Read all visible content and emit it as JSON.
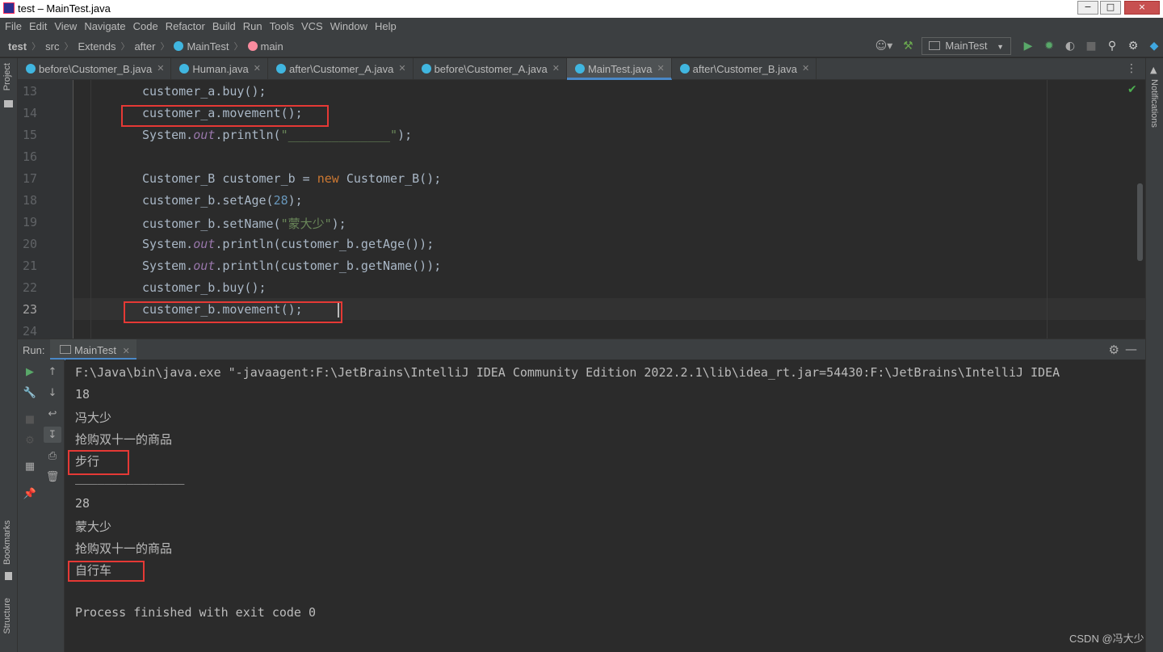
{
  "window": {
    "title": "test – MainTest.java",
    "min": "−",
    "max": "□",
    "close": "×"
  },
  "menu": [
    "File",
    "Edit",
    "View",
    "Navigate",
    "Code",
    "Refactor",
    "Build",
    "Run",
    "Tools",
    "VCS",
    "Window",
    "Help"
  ],
  "breadcrumbs": [
    "test",
    "src",
    "Extends",
    "after",
    "MainTest",
    "main"
  ],
  "toolbar": {
    "run_config": "MainTest"
  },
  "tabs": [
    {
      "label": "before\\Customer_B.java"
    },
    {
      "label": "Human.java"
    },
    {
      "label": "after\\Customer_A.java"
    },
    {
      "label": "before\\Customer_A.java"
    },
    {
      "label": "MainTest.java"
    },
    {
      "label": "after\\Customer_B.java"
    }
  ],
  "side": {
    "project": "Project",
    "bookmarks": "Bookmarks",
    "structure": "Structure",
    "notifications": "Notifications"
  },
  "editor": {
    "line_numbers": [
      "13",
      "14",
      "15",
      "16",
      "17",
      "18",
      "19",
      "20",
      "21",
      "22",
      "23",
      "24"
    ],
    "l13": "customer_a.buy();",
    "l14": "customer_a.movement();",
    "l15": {
      "pre": "System.",
      "field": "out",
      "mid": ".println(",
      "str": "\"______________\"",
      "post": ");"
    },
    "l17": {
      "t1": "Customer_B customer_b = ",
      "kw": "new",
      "t2": " Customer_B();"
    },
    "l18": {
      "pre": "customer_b.setAge(",
      "num": "28",
      "post": ");"
    },
    "l19": {
      "pre": "customer_b.setName(",
      "str": "\"蒙大少\"",
      "post": ");"
    },
    "l20": {
      "pre": "System.",
      "field": "out",
      "post": ".println(customer_b.getAge());"
    },
    "l21": {
      "pre": "System.",
      "field": "out",
      "post": ".println(customer_b.getName());"
    },
    "l22": "customer_b.buy();",
    "l23": "customer_b.movement();"
  },
  "run": {
    "label": "Run:",
    "tab": "MainTest",
    "output": [
      "F:\\Java\\bin\\java.exe \"-javaagent:F:\\JetBrains\\IntelliJ IDEA Community Edition 2022.2.1\\lib\\idea_rt.jar=54430:F:\\JetBrains\\IntelliJ IDEA",
      "18",
      "冯大少",
      "抢购双十一的商品",
      "步行",
      "_______________",
      "28",
      "蒙大少",
      "抢购双十一的商品",
      "自行车",
      "",
      "Process finished with exit code 0"
    ]
  },
  "watermark": "CSDN @冯大少",
  "colors": {
    "highlight": "#e53935",
    "keyword": "#cc7832",
    "string": "#6a8759",
    "number": "#6897bb",
    "field": "#9876aa"
  }
}
